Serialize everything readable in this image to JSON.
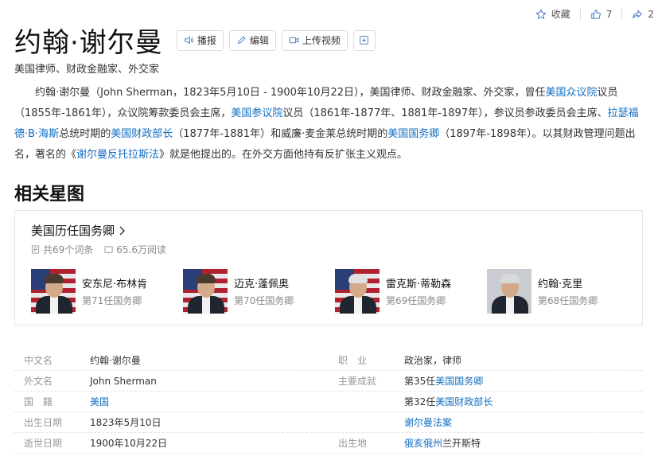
{
  "toolbar": {
    "collect": "收藏",
    "like_count": "7",
    "share_count": "2"
  },
  "header": {
    "title": "约翰·谢尔曼",
    "buttons": {
      "play": "播报",
      "edit": "编辑",
      "upload_video": "上传视频",
      "plus": "+"
    }
  },
  "subtitle": "美国律师、财政金融家、外交家",
  "intro": {
    "p1": "约翰·谢尔曼（John Sherman，1823年5月10日 - 1900年10月22日），美国律师、财政金融家、外交家，曾任",
    "l1": "美国众议院",
    "p2": "议员（1855年-1861年），众议院筹款委员会主席，",
    "l2": "美国参议院",
    "p3": "议员（1861年-1877年、1881年-1897年），参议员参政委员会主席、",
    "l3": "拉瑟福德·B·海斯",
    "p4": "总统时期的",
    "l4": "美国财政部长",
    "p5": "（1877年-1881年）和威廉·麦金莱总统时期的",
    "l5": "美国国务卿",
    "p6": "（1897年-1898年）。以其财政管理问题出名，著名的《",
    "l6": "谢尔曼反托拉斯法",
    "p7": "》就是他提出的。在外交方面他持有反扩张主义观点。"
  },
  "related": {
    "section_title": "相关星图",
    "card_title": "美国历任国务卿",
    "entries": "共69个词条",
    "views": "65.6万阅读",
    "persons": [
      {
        "name": "安东尼·布林肯",
        "desc": "第71任国务卿"
      },
      {
        "name": "迈克·蓬佩奥",
        "desc": "第70任国务卿"
      },
      {
        "name": "雷克斯·蒂勒森",
        "desc": "第69任国务卿"
      },
      {
        "name": "约翰·克里",
        "desc": "第68任国务卿"
      }
    ]
  },
  "info": {
    "rows": [
      {
        "k1": "中文名",
        "v1": "约翰·谢尔曼",
        "k2": "职　业",
        "v2": "政治家，律师"
      },
      {
        "k1": "外文名",
        "v1": "John Sherman",
        "k2": "主要成就",
        "v2a": "第35任",
        "v2l": "美国国务卿"
      },
      {
        "k1": "国　籍",
        "v1l": "美国",
        "k2": "",
        "v2a": "第32任",
        "v2l": "美国财政部长"
      },
      {
        "k1": "出生日期",
        "v1": "1823年5月10日",
        "k2": "",
        "v2l": "谢尔曼法案"
      },
      {
        "k1": "逝世日期",
        "v1": "1900年10月22日",
        "k2": "出生地",
        "v2l": "俄亥俄州",
        "v2b": "兰开斯特"
      }
    ]
  },
  "colors": {
    "link": "#136ec2",
    "muted": "#999999"
  }
}
